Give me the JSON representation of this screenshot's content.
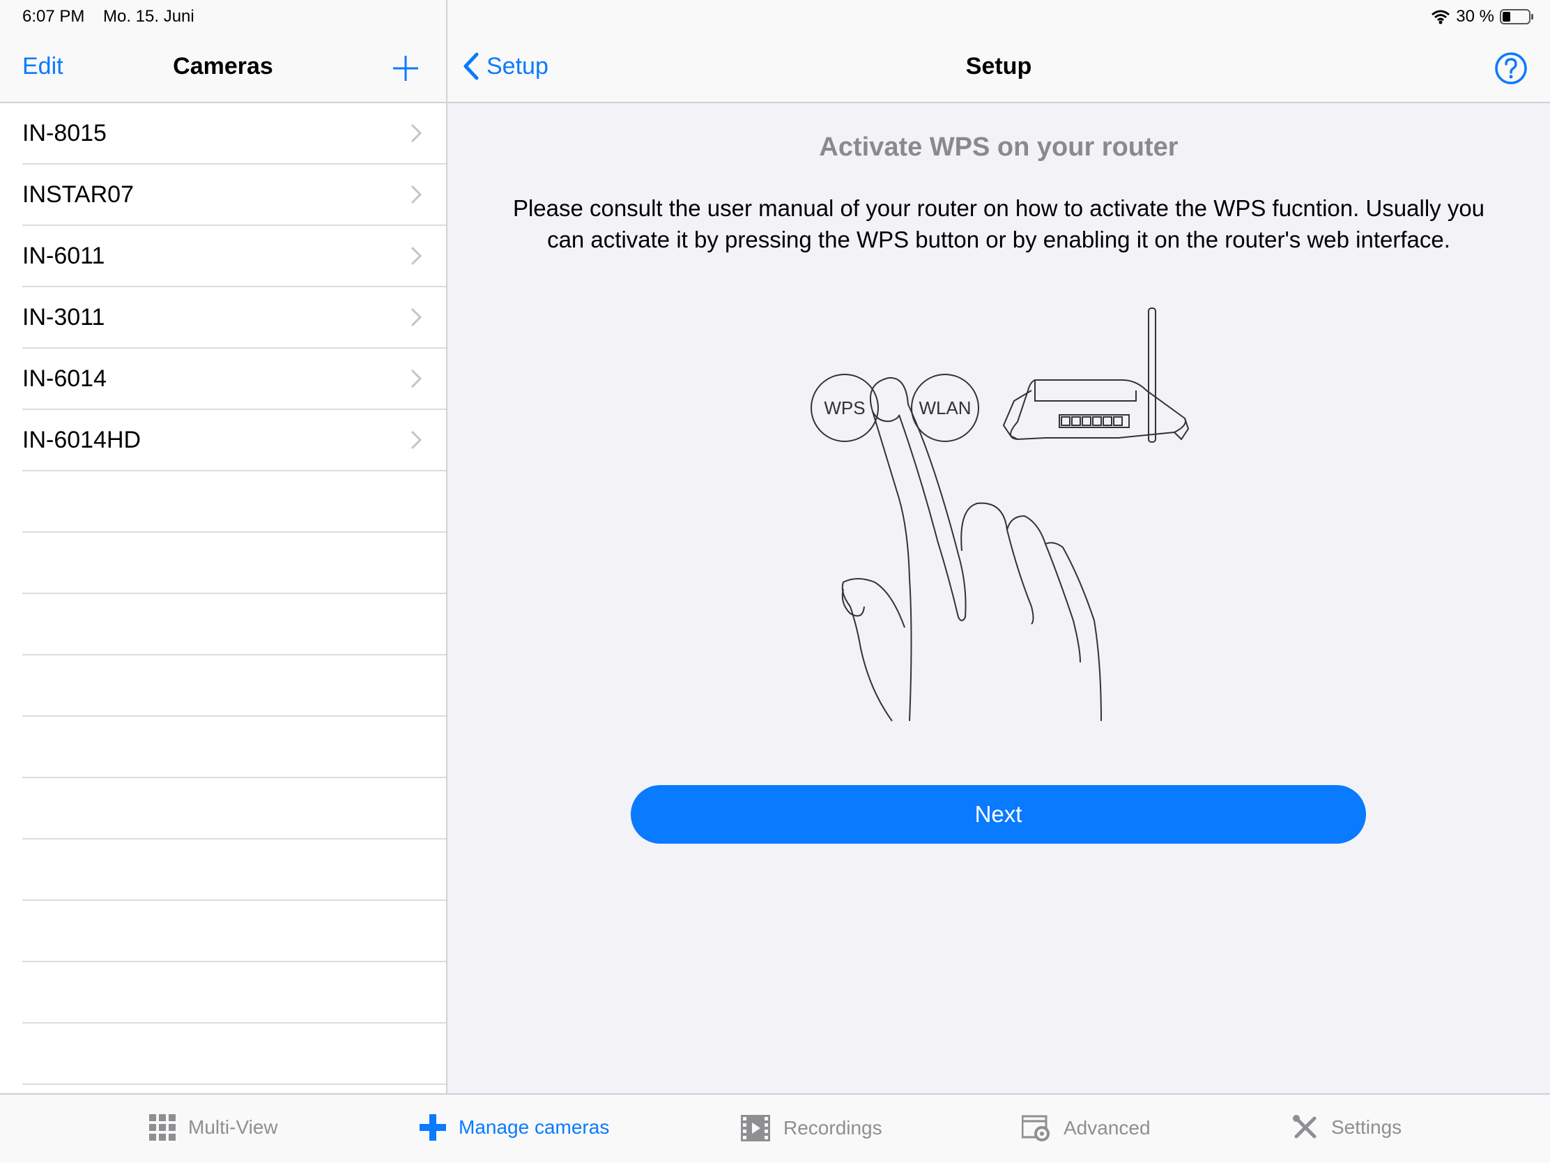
{
  "status_bar": {
    "time": "6:07 PM",
    "date": "Mo. 15. Juni",
    "battery": "30 %",
    "wifi_icon": "wifi-icon",
    "battery_icon": "battery-icon"
  },
  "master": {
    "edit_label": "Edit",
    "title": "Cameras",
    "add_icon": "plus-icon",
    "cameras": [
      {
        "name": "IN-8015"
      },
      {
        "name": "INSTAR07"
      },
      {
        "name": "IN-6011"
      },
      {
        "name": "IN-3011"
      },
      {
        "name": "IN-6014"
      },
      {
        "name": "IN-6014HD"
      }
    ]
  },
  "detail": {
    "back_label": "Setup",
    "title": "Setup",
    "help_icon": "question-circle-icon",
    "heading": "Activate WPS on your router",
    "body_line1": "Please consult the user manual of your router on how to activate the WPS fucntion. Usually you",
    "body_line2": "can activate it by pressing the WPS button or by enabling it on the router's web interface.",
    "illustration": {
      "wps_label": "WPS",
      "wlan_label": "WLAN"
    },
    "next_label": "Next"
  },
  "tab_bar": {
    "tabs": [
      {
        "label": "Multi-View",
        "icon": "grid-icon",
        "active": false
      },
      {
        "label": "Manage cameras",
        "icon": "plus-icon",
        "active": true
      },
      {
        "label": "Recordings",
        "icon": "film-icon",
        "active": false
      },
      {
        "label": "Advanced",
        "icon": "window-gear-icon",
        "active": false
      },
      {
        "label": "Settings",
        "icon": "tools-icon",
        "active": false
      }
    ]
  },
  "colors": {
    "accent": "#0a7aff",
    "background": "#f2f2f7",
    "inactive_tab": "#8e8e93",
    "heading_gray": "#8a8a8e"
  }
}
